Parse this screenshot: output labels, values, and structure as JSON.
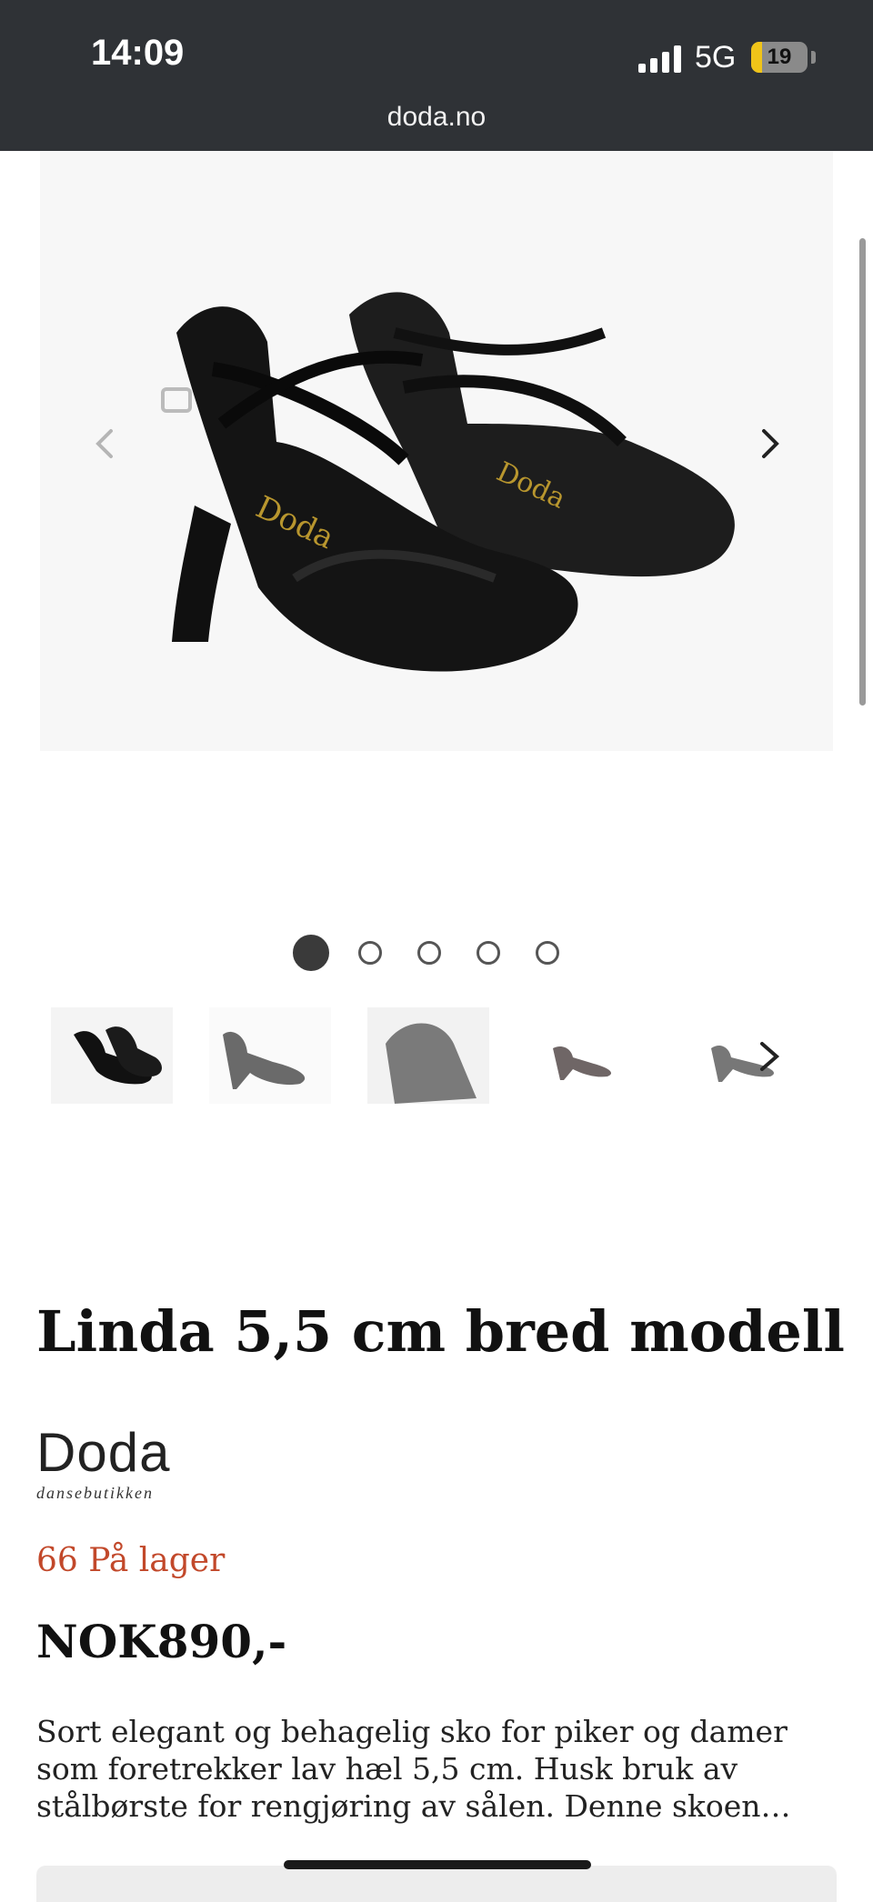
{
  "status_bar": {
    "time": "14:09",
    "network": "5G",
    "battery_level": "19",
    "battery_fraction": 0.19,
    "url": "doda.no"
  },
  "gallery": {
    "slide_count": 5,
    "active_slide": 1,
    "thumbnail_count": 5,
    "prev_icon": "chevron-left-icon",
    "next_icon": "chevron-right-icon"
  },
  "product": {
    "title": "Linda 5,5 cm bred modell",
    "brand_name": "Doda",
    "brand_tagline": "dansebutikken",
    "stock": "66 På lager",
    "price": "NOK890,-",
    "description_lines": [
      "Sort elegant og behagelig sko for piker og damer",
      "som foretrekker lav hæl  5,5 cm. Husk bruk av",
      "stålbørste for rengjøring av sålen.   Denne skoen…"
    ]
  },
  "colors": {
    "status_bar_bg": "#2f3236",
    "stock_color": "#c2482a",
    "battery_accent": "#f0c419"
  }
}
